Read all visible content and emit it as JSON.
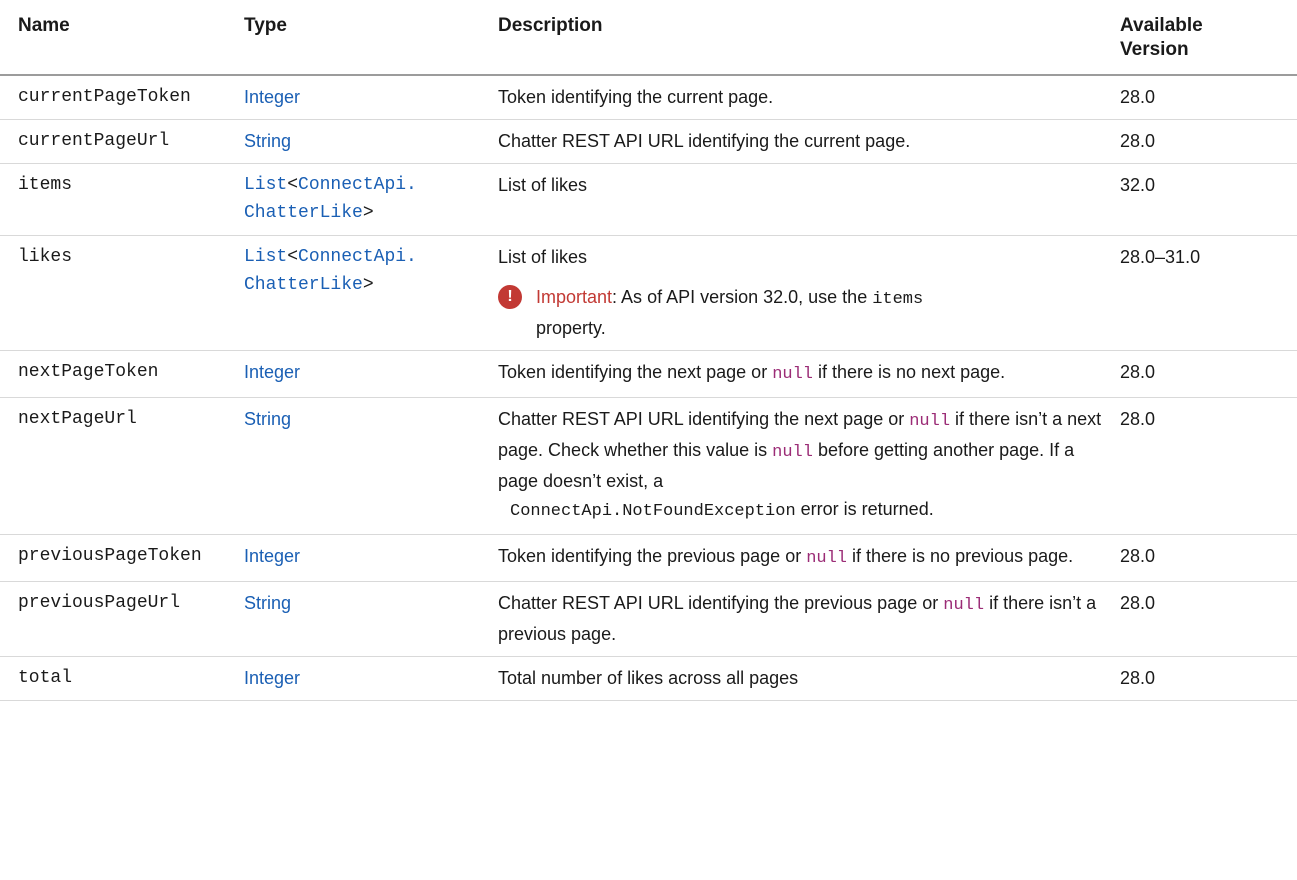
{
  "headers": {
    "name": "Name",
    "type": "Type",
    "description": "Description",
    "version_line1": "Available",
    "version_line2": "Version"
  },
  "rows": [
    {
      "name": "currentPageToken",
      "type": "Integer",
      "desc": "Token identifying the current page.",
      "version": "28.0"
    },
    {
      "name": "currentPageUrl",
      "type": "String",
      "desc": "Chatter REST API URL identifying the current page.",
      "version": "28.0"
    },
    {
      "name": "items",
      "type_prefix": "List<",
      "type_link1": "ConnectApi.",
      "type_link2": "ChatterLike",
      "type_suffix": ">",
      "desc": "List of likes",
      "version": "32.0"
    },
    {
      "name": "likes",
      "type_prefix": "List<",
      "type_link1": "ConnectApi.",
      "type_link2": "ChatterLike",
      "type_suffix": ">",
      "desc": "List of likes",
      "version": "28.0–31.0",
      "important_label": "Important",
      "important_text1": ":  As of API version 32.0, use the ",
      "important_code": "items",
      "important_text2": "property."
    },
    {
      "name": "nextPageToken",
      "type": "Integer",
      "desc1": "Token identifying the next page or ",
      "code": "null",
      "desc2": " if there is no next page.",
      "version": "28.0"
    },
    {
      "name": "nextPageUrl",
      "type": "String",
      "desc1": "Chatter REST API URL identifying the next page or ",
      "code": "null",
      "desc2": " if there isn’t a next page. Check whether this value is ",
      "code2": "null",
      "desc3": " before getting another page. If a page doesn’t exist, a",
      "exception": "ConnectApi.NotFoundException",
      "desc4": " error is returned.",
      "version": "28.0"
    },
    {
      "name": "previousPageToken",
      "type": "Integer",
      "desc1": "Token identifying the previous page or ",
      "code": "null",
      "desc2": " if there is no previous page.",
      "version": "28.0"
    },
    {
      "name": "previousPageUrl",
      "type": "String",
      "desc1": "Chatter REST API URL identifying the previous page or ",
      "code": "null",
      "desc2": " if there isn’t a previous page.",
      "version": "28.0"
    },
    {
      "name": "total",
      "type": "Integer",
      "desc": "Total number of likes across all pages",
      "version": "28.0"
    }
  ],
  "colors": {
    "link": "#1a5fb4",
    "code": "#9b2c76",
    "important": "#c23934"
  },
  "icons": {
    "important": "warning-circle-icon"
  }
}
